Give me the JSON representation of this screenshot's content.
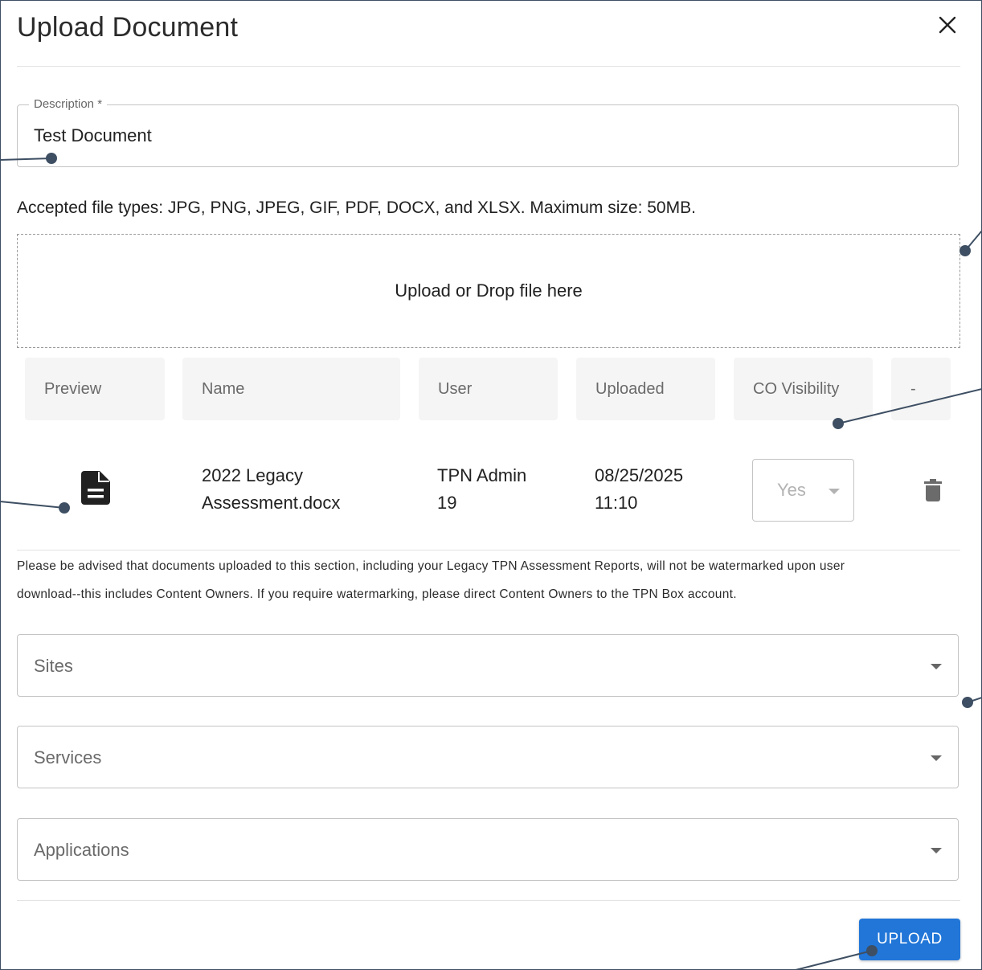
{
  "dialog": {
    "title": "Upload Document"
  },
  "description": {
    "label": "Description *",
    "value": "Test Document"
  },
  "accepted_types_text": "Accepted file types: JPG, PNG, JPEG, GIF, PDF, DOCX, and XLSX. Maximum size: 50MB.",
  "dropzone": {
    "label": "Upload or Drop file here"
  },
  "table": {
    "headers": [
      "Preview",
      "Name",
      "User",
      "Uploaded",
      "CO Visibility",
      "-"
    ],
    "rows": [
      {
        "preview_icon": "document-icon",
        "name_line1": "2022 Legacy",
        "name_line2": "Assessment.docx",
        "user_line1": "TPN Admin",
        "user_line2": "19",
        "uploaded_line1": "08/25/2025",
        "uploaded_line2": "11:10",
        "co_visibility": "Yes",
        "action_icon": "trash-icon"
      }
    ]
  },
  "advisory": {
    "line1": "Please be advised that documents uploaded to this section, including your Legacy TPN Assessment Reports, will not be watermarked upon user",
    "line2": "download--this includes Content Owners. If you require watermarking, please direct Content Owners to the TPN Box account."
  },
  "selects": {
    "sites": "Sites",
    "services": "Services",
    "applications": "Applications"
  },
  "actions": {
    "upload_label": "UPLOAD"
  },
  "colors": {
    "primary": "#2176d8",
    "callout": "#3e4f63"
  }
}
